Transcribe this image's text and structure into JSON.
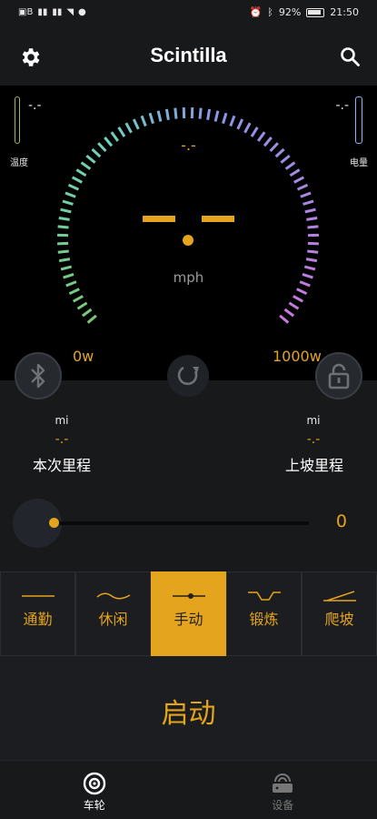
{
  "status_bar": {
    "left_icons": [
      "EB",
      "ⅈ",
      "ⅈ",
      "▾"
    ],
    "battery_pct": "92%",
    "time": "21:50"
  },
  "header": {
    "title": "Scintilla",
    "settings_icon": "gear-icon",
    "search_icon": "search-icon"
  },
  "dashboard": {
    "temp_value": "-.-",
    "temp_label": "温度",
    "battery_value": "-.-",
    "battery_label": "电量",
    "top_value": "-.-",
    "unit": "mph",
    "min_power": "0w",
    "max_power": "1000w"
  },
  "controls": {
    "bluetooth_icon": "bluetooth-icon",
    "refresh_icon": "refresh-icon",
    "lock_icon": "lock-icon"
  },
  "mileage": {
    "trip": {
      "unit": "mi",
      "value": "-.-",
      "label": "本次里程"
    },
    "uphill": {
      "unit": "mi",
      "value": "-.-",
      "label": "上坡里程"
    }
  },
  "slider": {
    "value": "0",
    "level": 0
  },
  "modes": [
    {
      "label": "通勤",
      "icon": "flat-line-icon",
      "active": false
    },
    {
      "label": "休闲",
      "icon": "wave-icon",
      "active": false
    },
    {
      "label": "手动",
      "icon": "manual-slider-icon",
      "active": true
    },
    {
      "label": "锻炼",
      "icon": "valley-icon",
      "active": false
    },
    {
      "label": "爬坡",
      "icon": "slope-icon",
      "active": false
    }
  ],
  "start": {
    "label": "启动"
  },
  "nav": {
    "items": [
      {
        "label": "车轮",
        "icon": "wheel-icon",
        "active": true
      },
      {
        "label": "设备",
        "icon": "device-icon",
        "active": false
      }
    ]
  },
  "colors": {
    "accent": "#e5a41d",
    "background": "#18191b",
    "panel": "#1c1d20"
  }
}
